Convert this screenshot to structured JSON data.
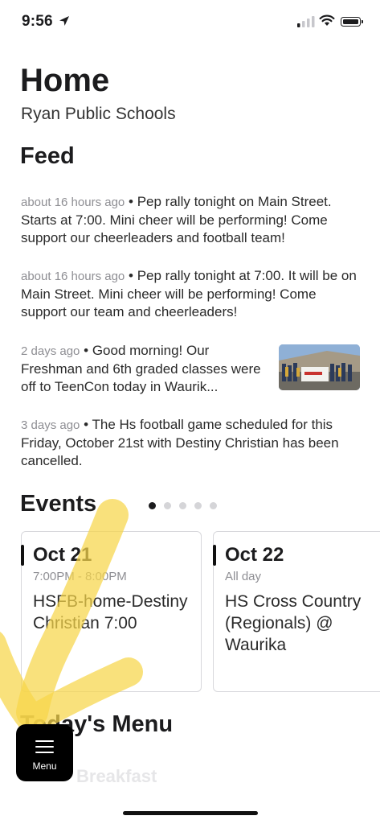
{
  "status": {
    "time": "9:56"
  },
  "header": {
    "title": "Home",
    "subtitle": "Ryan Public Schools"
  },
  "feed": {
    "title": "Feed",
    "separator": "•",
    "items": [
      {
        "time": "about 16 hours ago",
        "text": "Pep rally tonight on Main Street. Starts at 7:00. Mini cheer will be performing! Come support our cheerleaders and football team!"
      },
      {
        "time": "about 16 hours ago",
        "text": "Pep rally tonight at 7:00. It will be on Main Street. Mini cheer will be performing! Come support our team and cheerleaders!"
      },
      {
        "time": "2 days ago",
        "text": "Good morning! Our Freshman and 6th graded classes were off to TeenCon today in Waurik..."
      },
      {
        "time": "3 days ago",
        "text": "The Hs football game scheduled for this Friday, October 21st with Destiny Christian has been cancelled."
      }
    ]
  },
  "events": {
    "title": "Events",
    "page_count": 5,
    "active_page": 1,
    "cards": [
      {
        "date": "Oct 21",
        "time": "7:00PM - 8:00PM",
        "title": "HSFB-home-Destiny Christian 7:00"
      },
      {
        "date": "Oct 22",
        "time": "All day",
        "title": "HS Cross Country (Regionals) @ Waurika"
      }
    ]
  },
  "todays_menu": {
    "title": "Today's Menu",
    "first_meal": "Breakfast"
  },
  "menu_button": {
    "label": "Menu"
  },
  "colors": {
    "highlighter": "#f6d64a",
    "text": "#1c1c1e",
    "secondary_text": "#8e8e93"
  }
}
